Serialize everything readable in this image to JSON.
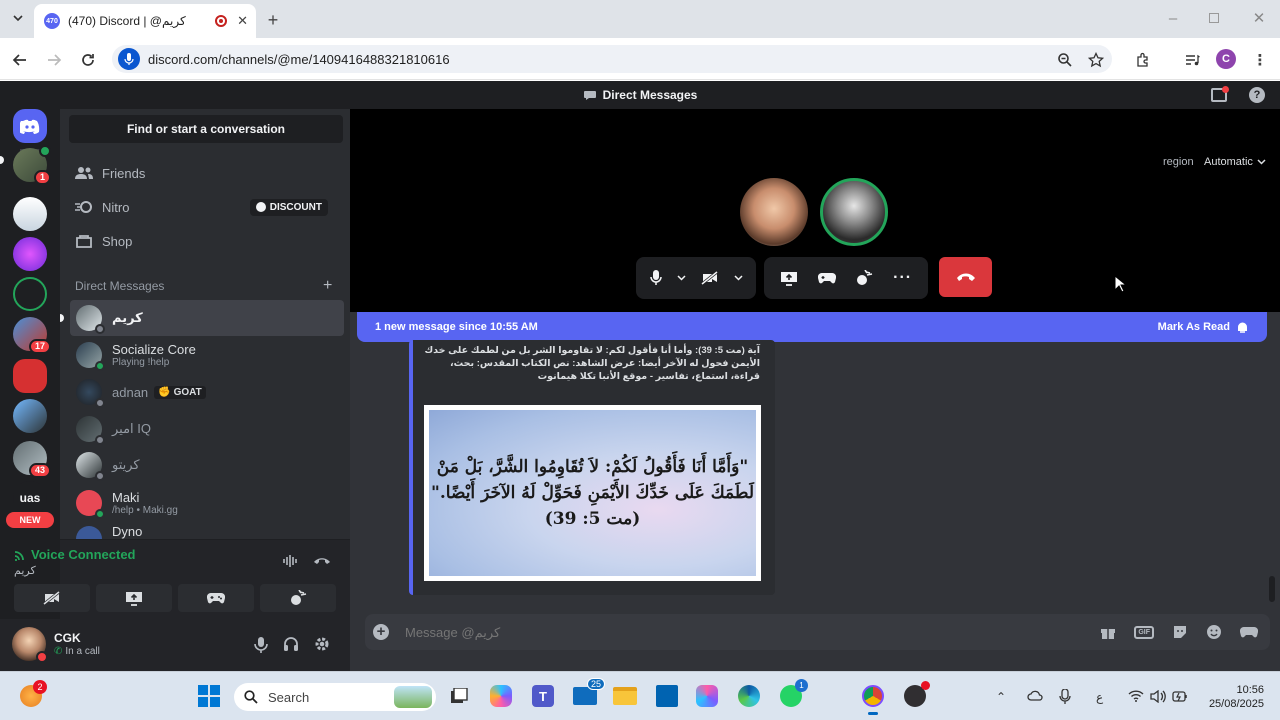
{
  "browser": {
    "tab_title": "(470) Discord | @كريم",
    "tab_badge": "470",
    "url": "discord.com/channels/@me/1409416488321810616",
    "profile_initial": "C"
  },
  "discord": {
    "top_title": "Direct Messages",
    "find_placeholder": "Find or start a conversation",
    "nav": {
      "friends": "Friends",
      "nitro": "Nitro",
      "discount": "DISCOUNT",
      "shop": "Shop"
    },
    "dm_header": "Direct Messages",
    "dms": [
      {
        "name": "كريم",
        "sub": "",
        "tag": ""
      },
      {
        "name": "Socialize Core",
        "sub": "Playing !help",
        "tag": ""
      },
      {
        "name": "adnan",
        "sub": "",
        "tag": "GOAT"
      },
      {
        "name": "امير IQ",
        "sub": "",
        "tag": ""
      },
      {
        "name": "كريتو",
        "sub": "",
        "tag": ""
      },
      {
        "name": "Maki",
        "sub": "/help • Maki.gg",
        "tag": ""
      },
      {
        "name": "Dyno",
        "sub": "",
        "tag": ""
      }
    ],
    "guild_badges": [
      "1",
      "17",
      "43"
    ],
    "guild_label": "uas",
    "new_label": "NEW",
    "voice": {
      "status": "Voice Connected",
      "channel": "كريم"
    },
    "user": {
      "name": "CGK",
      "status": "In a call"
    },
    "call": {
      "region_label": "region",
      "region_value": "Automatic"
    },
    "banner": {
      "text": "1 new message since 10:55 AM",
      "action": "Mark As Read"
    },
    "embed": {
      "text": "آية (مت 5: 39): وأما أنا فأقول لكم: لا تقاوموا الشر بل من لطمك على خدك الأيمن فحول له الآخر أيضا: عرض الشاهد: نص الكتاب المقدس: بحث، قراءة، استماع، تفاسير - موقع الأنبا تكلا هيمانوت",
      "image_line1": "\"وَأَمَّا أَنَا فَأَقُولُ لَكُمْ: لاَ تُقَاوِمُوا الشَّرَّ، بَلْ مَنْ",
      "image_line2": "لَطَمَكَ عَلَى خَدِّكَ الأَيْمَنِ فَحَوِّلْ لَهُ الآخَرَ أَيْضًا.\"",
      "image_line3": "(مت 5: 39)"
    },
    "message_placeholder": "Message @كريم"
  },
  "taskbar": {
    "search_label": "Search",
    "start_badge": "2",
    "outlook_badge": "25",
    "whatsapp_badge": "1",
    "lang": "ع",
    "time": "10:56",
    "date": "25/08/2025"
  },
  "colors": {
    "blurple": "#5865f2",
    "green": "#23a55a",
    "red": "#da373c"
  }
}
